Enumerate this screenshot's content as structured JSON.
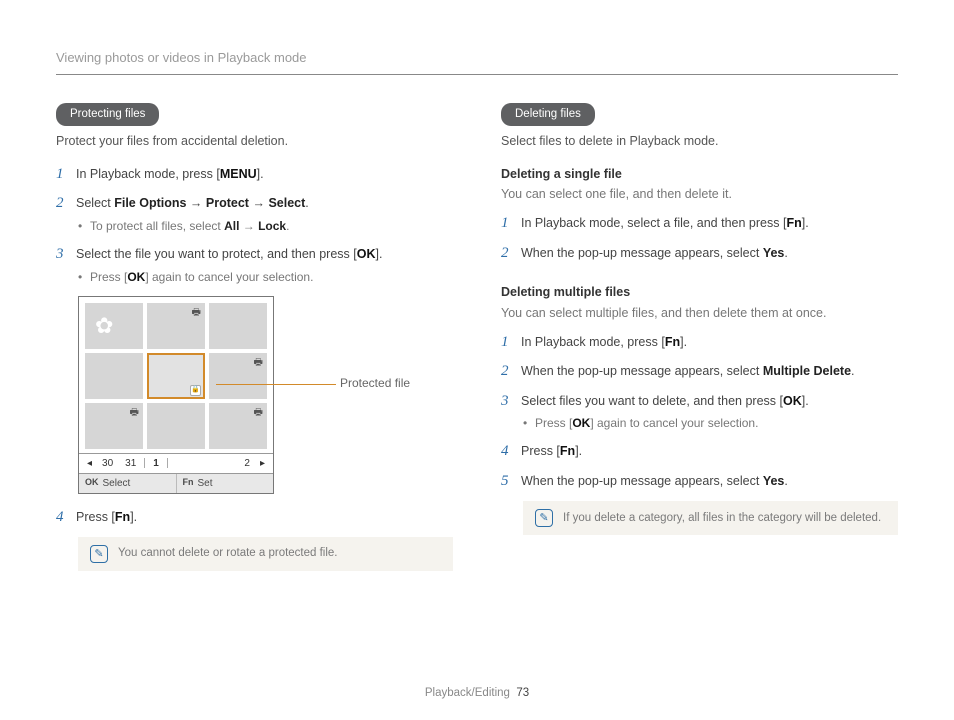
{
  "header": "Viewing photos or videos in Playback mode",
  "left": {
    "badge": "Protecting files",
    "intro": "Protect your files from accidental deletion.",
    "step1_a": "In Playback mode, press [",
    "step1_btn": "MENU",
    "step1_b": "].",
    "step2_a": "Select ",
    "step2_b1": "File Options",
    "step2_arrow": " → ",
    "step2_b2": "Protect",
    "step2_b3": "Select",
    "step2_end": ".",
    "step2_sub_a": "To protect all files, select ",
    "step2_sub_b1": "All",
    "step2_sub_b2": "Lock",
    "step2_sub_end": ".",
    "step3_a": "Select the file you want to protect, and then press [",
    "step3_btn": "OK",
    "step3_b": "].",
    "step3_sub_a": "Press [",
    "step3_sub_btn": "OK",
    "step3_sub_b": "] again to cancel your selection.",
    "callout": "Protected file",
    "date_30": "30",
    "date_31": "31",
    "date_1": "1",
    "date_2": "2",
    "foot_ok": "OK",
    "foot_select": "Select",
    "foot_fn": "Fn",
    "foot_set": "Set",
    "step4_a": "Press [",
    "step4_btn": "Fn",
    "step4_b": "].",
    "note": "You cannot delete or rotate a protected file."
  },
  "right": {
    "badge": "Deleting files",
    "intro": "Select files to delete in Playback mode.",
    "sub1_head": "Deleting a single file",
    "sub1_text": "You can select one file, and then delete it.",
    "s1_step1_a": "In Playback mode, select a file, and then press [",
    "s1_step1_btn": "Fn",
    "s1_step1_b": "].",
    "s1_step2_a": "When the pop-up message appears, select ",
    "s1_step2_b": "Yes",
    "s1_step2_c": ".",
    "sub2_head": "Deleting multiple files",
    "sub2_text": "You can select multiple files, and then delete them at once.",
    "s2_step1_a": "In Playback mode, press [",
    "s2_step1_btn": "Fn",
    "s2_step1_b": "].",
    "s2_step2_a": "When the pop-up message appears, select ",
    "s2_step2_b": "Multiple Delete",
    "s2_step2_c": ".",
    "s2_step3_a": "Select files you want to delete, and then press [",
    "s2_step3_btn": "OK",
    "s2_step3_b": "].",
    "s2_step3_sub_a": "Press [",
    "s2_step3_sub_btn": "OK",
    "s2_step3_sub_b": "] again to cancel your selection.",
    "s2_step4_a": "Press [",
    "s2_step4_btn": "Fn",
    "s2_step4_b": "].",
    "s2_step5_a": "When the pop-up message appears, select ",
    "s2_step5_b": "Yes",
    "s2_step5_c": ".",
    "note": "If you delete a category, all files in the category will be deleted."
  },
  "footer": {
    "section": "Playback/Editing",
    "page": "73"
  }
}
